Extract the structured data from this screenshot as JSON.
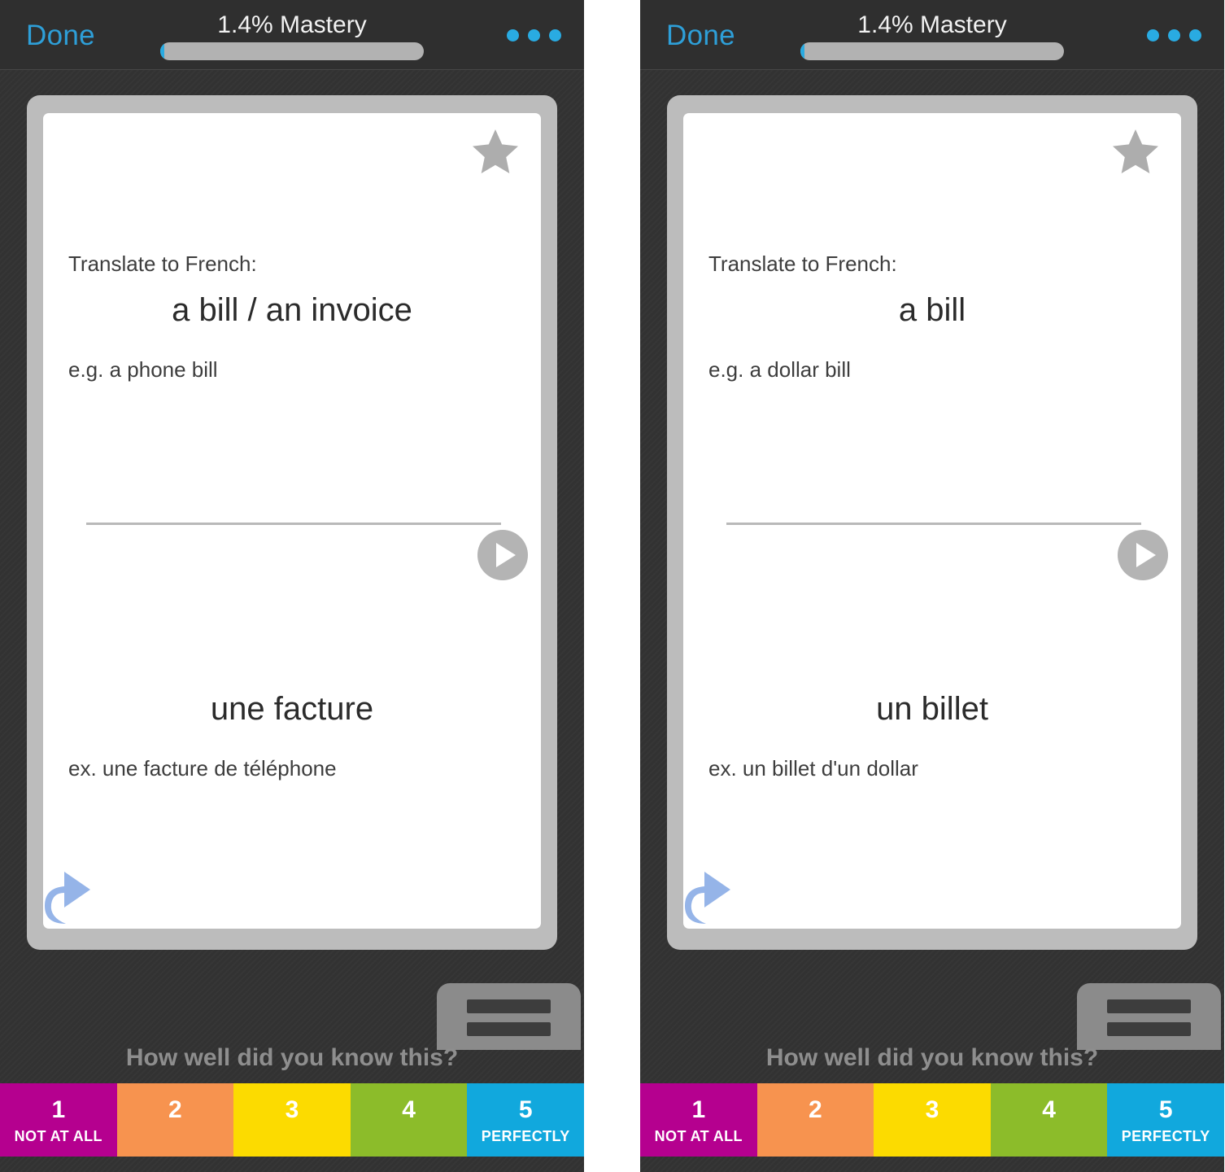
{
  "app": {
    "background_color": "#333333",
    "header_color": "#2f2f2f",
    "accent_color": "#29abe2"
  },
  "panels": [
    {
      "header": {
        "done_label": "Done",
        "mastery_label": "1.4% Mastery",
        "progress_percent": 1.4,
        "overflow_menu_name": "more-options"
      },
      "card": {
        "starred": true,
        "prompt_label": "Translate to French:",
        "term": "a bill / an invoice",
        "term_example": "e.g. a phone bill",
        "answer": "une facture",
        "answer_example": "ex. une facture de téléphone",
        "audio_button_name": "play-audio"
      },
      "footer": {
        "question": "How well did you know this?",
        "ratings": [
          {
            "number": "1",
            "sublabel": "NOT AT ALL",
            "color": "#b5008f"
          },
          {
            "number": "2",
            "sublabel": "",
            "color": "#f7934f"
          },
          {
            "number": "3",
            "sublabel": "",
            "color": "#fcdb00"
          },
          {
            "number": "4",
            "sublabel": "",
            "color": "#8cbc2a"
          },
          {
            "number": "5",
            "sublabel": "PERFECTLY",
            "color": "#11a8dd"
          }
        ]
      }
    },
    {
      "header": {
        "done_label": "Done",
        "mastery_label": "1.4% Mastery",
        "progress_percent": 1.4,
        "overflow_menu_name": "more-options"
      },
      "card": {
        "starred": true,
        "prompt_label": "Translate to French:",
        "term": "a bill",
        "term_example": "e.g. a dollar bill",
        "answer": "un billet",
        "answer_example": "ex. un billet d'un dollar",
        "audio_button_name": "play-audio"
      },
      "footer": {
        "question": "How well did you know this?",
        "ratings": [
          {
            "number": "1",
            "sublabel": "NOT AT ALL",
            "color": "#b5008f"
          },
          {
            "number": "2",
            "sublabel": "",
            "color": "#f7934f"
          },
          {
            "number": "3",
            "sublabel": "",
            "color": "#fcdb00"
          },
          {
            "number": "4",
            "sublabel": "",
            "color": "#8cbc2a"
          },
          {
            "number": "5",
            "sublabel": "PERFECTLY",
            "color": "#11a8dd"
          }
        ]
      }
    }
  ]
}
